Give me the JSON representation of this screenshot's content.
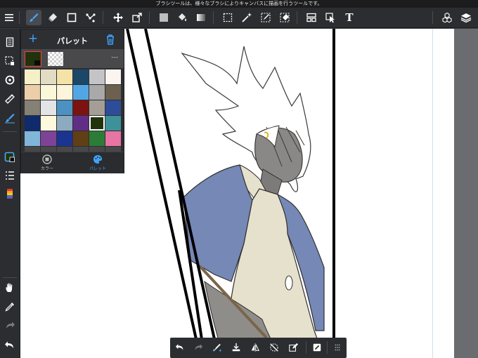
{
  "hint_bar": {
    "text": "ブラシツールは、様々なブラシによりキャンバスに描画を行うツールです。"
  },
  "toolbar": {
    "items": [
      {
        "name": "menu-icon"
      },
      {
        "name": "brush-tool-icon"
      },
      {
        "name": "eraser-tool-icon"
      },
      {
        "name": "rect-tool-icon"
      },
      {
        "name": "dot-tool-icon"
      },
      {
        "name": "move-tool-icon"
      },
      {
        "name": "transform-tool-icon"
      },
      {
        "name": "fill-square-icon"
      },
      {
        "name": "bucket-tool-icon"
      },
      {
        "name": "gradient-tool-icon"
      },
      {
        "name": "select-rect-icon"
      },
      {
        "name": "magic-wand-icon"
      },
      {
        "name": "select-pen-icon"
      },
      {
        "name": "select-eraser-icon"
      },
      {
        "name": "frame-tool-icon"
      },
      {
        "name": "operation-tool-icon"
      },
      {
        "name": "text-tool-icon"
      },
      {
        "name": "materials-icon"
      },
      {
        "name": "layers-icon"
      }
    ],
    "text_icon_glyph": "T"
  },
  "palette": {
    "add_label": "+",
    "title": "パレット",
    "current_more": "---",
    "current_color": "#21330d",
    "swatches": [
      "#f6f0c6",
      "#e2dcc4",
      "#f4e3a6",
      "#1b4868",
      "#c4c4c6",
      "#fcf5ef",
      "#eccfa8",
      "#fbf8da",
      "#fdf4dc",
      "#52a6e5",
      "#a9a9a9",
      "#6c604f",
      "#868175",
      "#e3e4e5",
      "#4b92c3",
      "#7c1310",
      "#a59e97",
      "#2d4d98",
      "#0f2b6b",
      "#fcf9dd",
      "#8cabc1",
      "#612e85",
      "#21330d",
      "#3c9298",
      "#80b6da",
      "#7d4397",
      "#1b3491",
      "#603e16",
      "#2b7c36",
      "#e774a3",
      "#484848",
      "#484848",
      "#484848",
      "#484848",
      "#484848",
      "#484848"
    ],
    "footer": [
      {
        "label": "カラー"
      },
      {
        "label": "パレット"
      }
    ]
  },
  "bottom_bar": {
    "items": [
      {
        "name": "undo-icon"
      },
      {
        "name": "redo-icon"
      },
      {
        "name": "snap-icon"
      },
      {
        "name": "import-icon"
      },
      {
        "name": "flip-icon"
      },
      {
        "name": "cancel-select-icon"
      },
      {
        "name": "edit-icon"
      },
      {
        "name": "fill-icon"
      },
      {
        "name": "more-icon"
      }
    ]
  }
}
